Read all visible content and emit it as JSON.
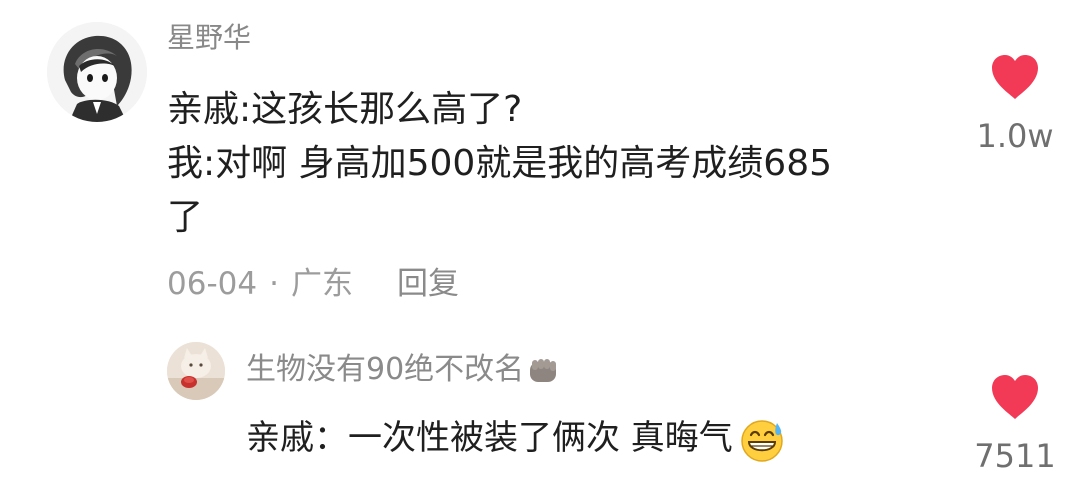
{
  "comment": {
    "username": "星野华",
    "text_lines": [
      "亲戚:这孩长那么高了?",
      "我:对啊 身高加500就是我的高考成绩685",
      "了"
    ],
    "date": "06-04",
    "separator": "·",
    "location": "广东",
    "reply_label": "回复",
    "like_count": "1.0w",
    "like_icon": "heart-icon",
    "avatar": "anime-avatar"
  },
  "reply": {
    "username": "生物没有90绝不改名",
    "username_badge_icon": "fist-icon",
    "text": "亲戚：一次性被装了俩次 真晦气",
    "trailing_emoji": "grinning-sweat-emoji",
    "like_count": "7511",
    "like_icon": "heart-icon",
    "avatar": "cat-avatar"
  },
  "colors": {
    "heart": "#f23a57",
    "meta_text": "#9c9c9c",
    "username_text": "#888888",
    "body_text": "#1f1f1f"
  }
}
